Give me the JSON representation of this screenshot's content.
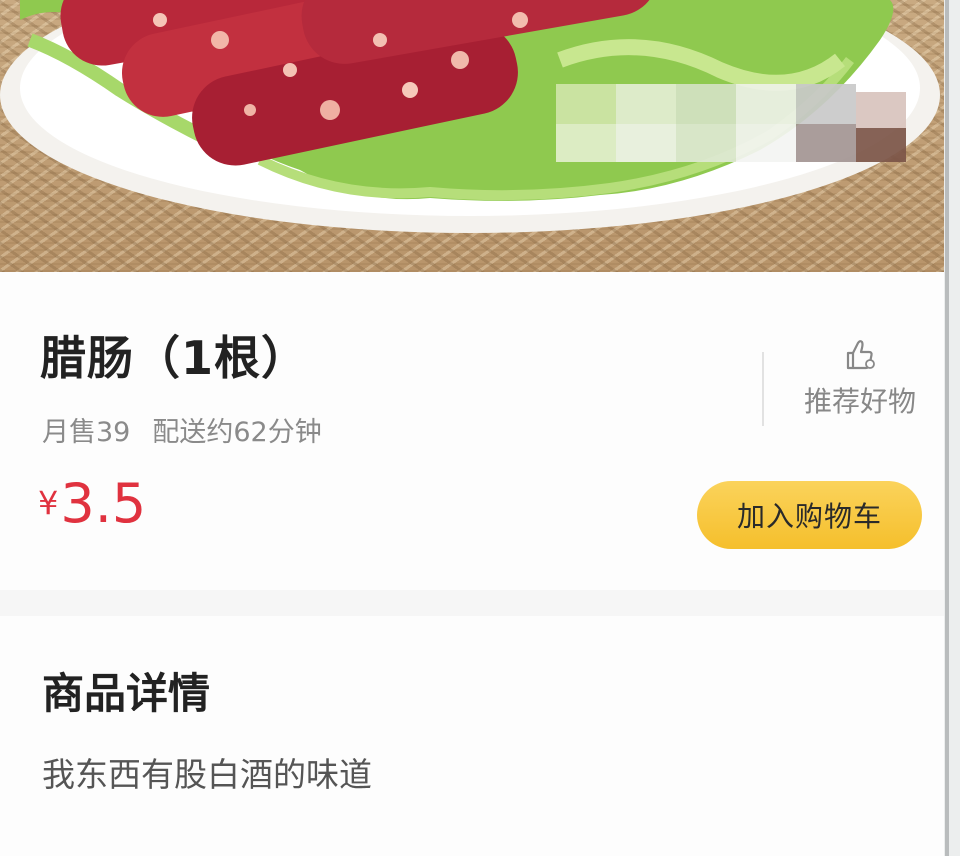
{
  "product": {
    "title": "腊肠（1根）",
    "monthly_sales": "月售39",
    "delivery": "配送约62分钟",
    "currency": "¥",
    "price": "3.5",
    "recommend_label": "推荐好物",
    "add_to_cart_label": "加入购物车"
  },
  "detail": {
    "heading": "商品详情",
    "description": "我东西有股白酒的味道"
  },
  "colors": {
    "price": "#e0323f",
    "cart_button": "#f7c640",
    "background": "#f6f6f6"
  },
  "icons": {
    "recommend": "thumbs-up-icon"
  }
}
